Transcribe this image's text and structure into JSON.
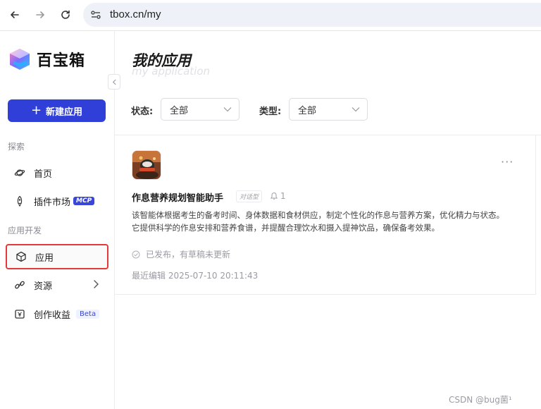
{
  "browser": {
    "url": "tbox.cn/my"
  },
  "sidebar": {
    "logo_text": "百宝箱",
    "new_button_label": "新建应用",
    "groups": {
      "explore": "探索",
      "dev": "应用开发"
    },
    "items": [
      {
        "label": "首页",
        "icon": "planet-icon"
      },
      {
        "label": "插件市场",
        "icon": "rocket-icon",
        "badge": "MCP"
      },
      {
        "label": "应用",
        "icon": "cube-icon",
        "active": true
      },
      {
        "label": "资源",
        "icon": "link-icon",
        "has_chevron": true
      },
      {
        "label": "创作收益",
        "icon": "wallet-icon",
        "badge": "Beta"
      }
    ]
  },
  "main": {
    "title": "我的应用",
    "subtitle": "my application",
    "filters": {
      "status_label": "状态:",
      "status_value": "全部",
      "type_label": "类型:",
      "type_value": "全部"
    },
    "card": {
      "name": "作息营养规划智能助手",
      "type_tag": "对话型",
      "likes": "1",
      "description": "该智能体根据考生的备考时间、身体数据和食材供应，制定个性化的作息与营养方案，优化精力与状态。它提供科学的作息安排和营养食谱，并提醒合理饮水和摄入提神饮品，确保备考效果。",
      "status": "已发布，有草稿未更新",
      "last_edited": "最近编辑 2025-07-10 20:11:43",
      "more": "···"
    }
  },
  "watermark": "CSDN @bug菌¹",
  "colors": {
    "primary": "#2f3fd8",
    "highlight_border": "#e23a3a"
  }
}
